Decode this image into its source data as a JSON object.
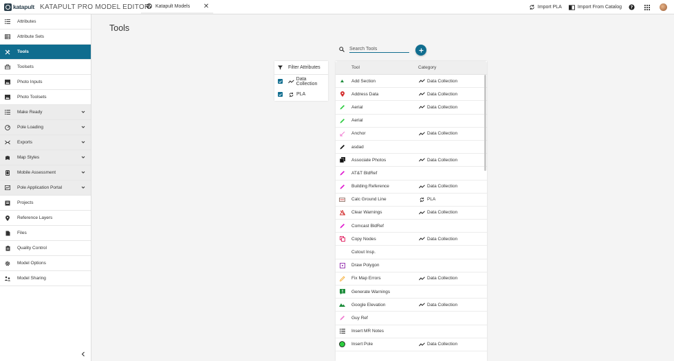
{
  "header": {
    "logo_text": "katapult",
    "app_title": "KATAPULT PRO MODEL EDITOR",
    "tab_label": "Katapult Models",
    "tab_close": "✕",
    "import_pla": "Import PLA",
    "import_catalog": "Import From Catalog"
  },
  "sidebar": {
    "items": [
      {
        "label": "Attributes",
        "icon": "list-icon"
      },
      {
        "label": "Attribute Sets",
        "icon": "table-icon"
      },
      {
        "label": "Tools",
        "icon": "tools-icon"
      },
      {
        "label": "Toolsets",
        "icon": "toolbox-icon"
      },
      {
        "label": "Photo Inputs",
        "icon": "photo-icon"
      },
      {
        "label": "Photo Toolsets",
        "icon": "photo-icon"
      },
      {
        "label": "Make Ready",
        "icon": "checklist-icon"
      },
      {
        "label": "Pole Loading",
        "icon": "pole-loading-icon"
      },
      {
        "label": "Exports",
        "icon": "exports-icon"
      },
      {
        "label": "Map Styles",
        "icon": "map-styles-icon"
      },
      {
        "label": "Mobile Assessment",
        "icon": "mobile-icon"
      },
      {
        "label": "Pole Application Portal",
        "icon": "portal-icon"
      },
      {
        "label": "Projects",
        "icon": "projects-icon"
      },
      {
        "label": "Reference Layers",
        "icon": "location-icon"
      },
      {
        "label": "Files",
        "icon": "file-icon"
      },
      {
        "label": "Quality Control",
        "icon": "clipboard-icon"
      },
      {
        "label": "Model Options",
        "icon": "gear-icon"
      },
      {
        "label": "Model Sharing",
        "icon": "share-icon"
      }
    ]
  },
  "main": {
    "title": "Tools",
    "search_placeholder": "Search Tools"
  },
  "filter": {
    "header": "Filter Attributes",
    "options": [
      {
        "label": "Data Collection",
        "checked": true
      },
      {
        "label": "PLA",
        "checked": true
      }
    ]
  },
  "table": {
    "col_tool": "Tool",
    "col_category": "Category",
    "rows": [
      {
        "name": "Add Section",
        "category": "Data Collection",
        "icon": "add-section-icon",
        "color": "#1c8c3a"
      },
      {
        "name": "Address Data",
        "category": "Data Collection",
        "icon": "map-pin-icon",
        "color": "#d32f2f"
      },
      {
        "name": "Aerial",
        "category": "Data Collection",
        "icon": "pencil-icon",
        "color": "#2ecc40"
      },
      {
        "name": "Aerial",
        "category": "",
        "icon": "pencil-icon",
        "color": "#2ecc40"
      },
      {
        "name": "Anchor",
        "category": "Data Collection",
        "icon": "anchor-icon",
        "color": "#f07ad0"
      },
      {
        "name": "asdad",
        "category": "",
        "icon": "pencil-icon",
        "color": "#111111"
      },
      {
        "name": "Associate Photos",
        "category": "Data Collection",
        "icon": "photos-icon",
        "color": "#111111"
      },
      {
        "name": "AT&T BldRef",
        "category": "",
        "icon": "pencil-icon",
        "color": "#e01ad0"
      },
      {
        "name": "Building Reference",
        "category": "Data Collection",
        "icon": "pencil-icon",
        "color": "#e01ad0"
      },
      {
        "name": "Calc Ground Line",
        "category": "PLA",
        "icon": "ground-line-icon",
        "color": "#8d6e63"
      },
      {
        "name": "Clear Warnings",
        "category": "Data Collection",
        "icon": "clear-warnings-icon",
        "color": "#d32f2f"
      },
      {
        "name": "Comcast BldRef",
        "category": "",
        "icon": "pencil-icon",
        "color": "#e01ad0"
      },
      {
        "name": "Copy Nodes",
        "category": "Data Collection",
        "icon": "copy-icon",
        "color": "#e0185a"
      },
      {
        "name": "Cutout Insp.",
        "category": "",
        "icon": "",
        "color": ""
      },
      {
        "name": "Draw Polygon",
        "category": "",
        "icon": "polygon-icon",
        "color": "#8e24aa"
      },
      {
        "name": "Fix Map Errors",
        "category": "Data Collection",
        "icon": "fix-icon",
        "color": "#f5a623"
      },
      {
        "name": "Generate Warnings",
        "category": "",
        "icon": "warning-icon",
        "color": "#1c8c3a"
      },
      {
        "name": "Google Elevation",
        "category": "Data Collection",
        "icon": "terrain-icon",
        "color": "#1c8c3a"
      },
      {
        "name": "Guy Ref",
        "category": "",
        "icon": "pencil-icon",
        "color": "#f07ad0"
      },
      {
        "name": "Insert MR Notes",
        "category": "",
        "icon": "list-icon",
        "color": "#111111"
      },
      {
        "name": "Insert Pole",
        "category": "Data Collection",
        "icon": "pole-icon",
        "color": "#2ecc40"
      }
    ]
  },
  "colors": {
    "accent": "#106d8f",
    "sidebar_group_bg": "#ececec",
    "page_bg": "#f4f4f4"
  }
}
